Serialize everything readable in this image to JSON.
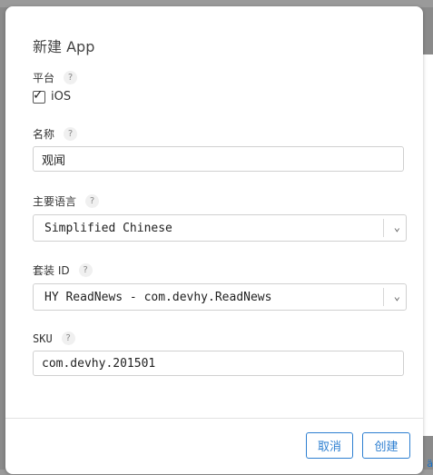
{
  "backdrop": {
    "link_text": "ä"
  },
  "dialog": {
    "title": "新建 App",
    "help_glyph": "?",
    "platform": {
      "label": "平台",
      "option_label": "iOS",
      "checked": true
    },
    "name": {
      "label": "名称",
      "value": "观闻"
    },
    "primary_language": {
      "label": "主要语言",
      "selected": "Simplified Chinese"
    },
    "bundle_id": {
      "label": "套装 ID",
      "selected": "HY ReadNews - com.devhy.ReadNews"
    },
    "sku": {
      "label": "SKU",
      "value": "com.devhy.201501"
    },
    "buttons": {
      "cancel": "取消",
      "create": "创建"
    }
  },
  "colors": {
    "accent": "#2d7fd1",
    "overlay": "#8a8a8a"
  }
}
